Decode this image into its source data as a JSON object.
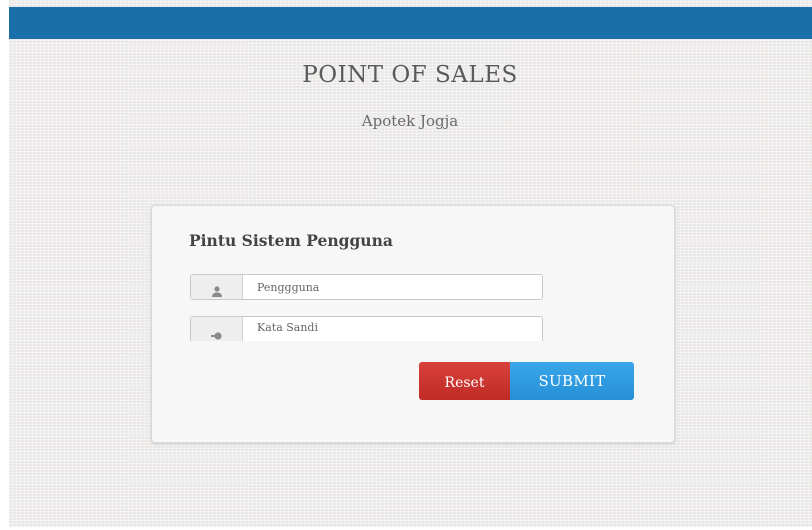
{
  "header": {
    "app_title": "POINT OF SALES",
    "app_subtitle": "Apotek Jogja"
  },
  "login_panel": {
    "title": "Pintu Sistem Pengguna",
    "username": {
      "placeholder": "Penggguna",
      "value": "",
      "icon": "user-icon"
    },
    "password": {
      "placeholder": "Kata Sandi",
      "value": "",
      "icon": "key-icon"
    },
    "reset_label": "Reset",
    "submit_label": "SUBMIT"
  },
  "colors": {
    "topbar": "#1b6fa8",
    "reset_button": "#c9302c",
    "submit_button": "#2f9be0",
    "background": "#f0efee"
  }
}
